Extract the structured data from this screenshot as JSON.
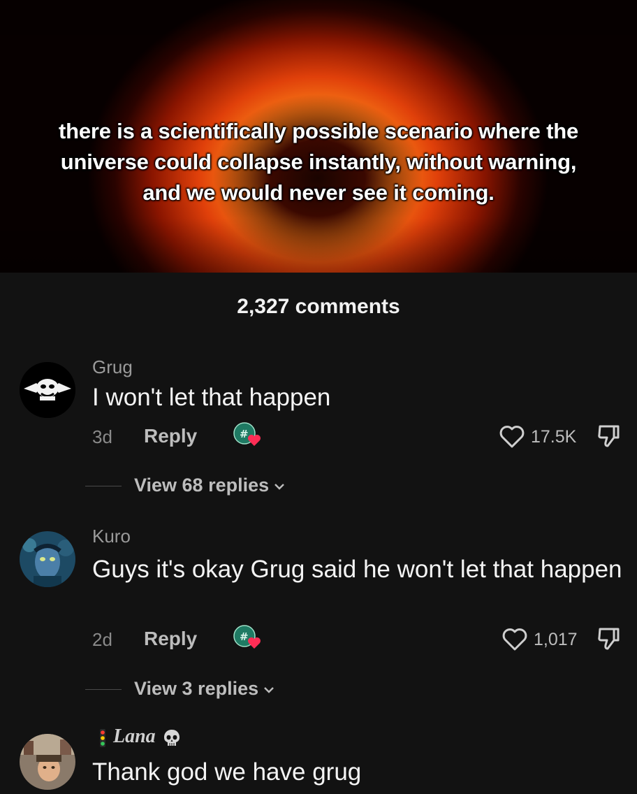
{
  "post": {
    "caption": "there is a scientifically possible scenario where the universe could collapse instantly, without warning, and we would never see it coming."
  },
  "comments_header": {
    "count_label": "2,327 comments"
  },
  "comments": [
    {
      "username": "Grug",
      "text": "I won't let that happen",
      "time": "3d",
      "reply_label": "Reply",
      "likes": "17.5K",
      "view_replies": "View 68 replies"
    },
    {
      "username": "Kuro",
      "text": "Guys it's okay Grug said he won't let that happen",
      "time": "2d",
      "reply_label": "Reply",
      "likes": "1,017",
      "view_replies": "View 3 replies"
    },
    {
      "username": "Lana",
      "text": "Thank god we have grug"
    }
  ],
  "icons": {
    "heart": "heart-outline-icon",
    "dislike": "thumbs-down-outline-icon",
    "sticker": "creator-heart-sticker-icon",
    "chevron": "chevron-down-icon"
  },
  "colors": {
    "background": "#121212",
    "sticker_badge": "#1f7a63",
    "sticker_heart": "#ff2d55"
  }
}
